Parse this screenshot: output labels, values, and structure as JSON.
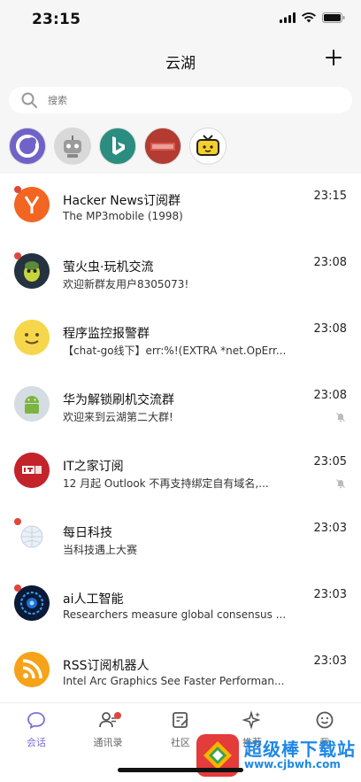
{
  "status": {
    "time": "23:15"
  },
  "header": {
    "title": "云湖",
    "add_icon": "plus-icon"
  },
  "search": {
    "placeholder": "搜索"
  },
  "stories": [
    {
      "name": "story-app-1",
      "icon": "rocket-moon-icon"
    },
    {
      "name": "story-app-2",
      "icon": "robot-icon"
    },
    {
      "name": "story-app-3",
      "icon": "bing-icon"
    },
    {
      "name": "story-app-4",
      "icon": "news-badge-icon"
    },
    {
      "name": "story-app-5",
      "icon": "tv-icon"
    }
  ],
  "chats": [
    {
      "title": "Hacker News订阅群",
      "subtitle": "The MP3mobile (1998)",
      "time": "23:15",
      "unread": true,
      "muted": false
    },
    {
      "title": "萤火虫·玩机交流",
      "subtitle": "欢迎新群友用户8305073!",
      "time": "23:08",
      "unread": true,
      "muted": false
    },
    {
      "title": "程序监控报警群",
      "subtitle": "【chat-go线下】err:%!(EXTRA *net.OpErr...",
      "time": "23:08",
      "unread": false,
      "muted": false
    },
    {
      "title": "华为解锁刷机交流群",
      "subtitle": "欢迎来到云湖第二大群!",
      "time": "23:08",
      "unread": false,
      "muted": true
    },
    {
      "title": "IT之家订阅",
      "subtitle": "12 月起 Outlook 不再支持绑定自有域名,...",
      "time": "23:05",
      "unread": false,
      "muted": true
    },
    {
      "title": "每日科技",
      "subtitle": "当科技遇上大赛",
      "time": "23:03",
      "unread": true,
      "muted": false
    },
    {
      "title": "ai人工智能",
      "subtitle": "Researchers measure global consensus ...",
      "time": "23:03",
      "unread": true,
      "muted": false
    },
    {
      "title": "RSS订阅机器人",
      "subtitle": "Intel Arc Graphics See Faster Performan...",
      "time": "23:03",
      "unread": false,
      "muted": false
    }
  ],
  "tabs": [
    {
      "label": "会话",
      "icon": "chat-bubble-icon",
      "active": true
    },
    {
      "label": "通讯录",
      "icon": "contacts-icon",
      "active": false,
      "badge": true
    },
    {
      "label": "社区",
      "icon": "community-icon",
      "active": false
    },
    {
      "label": "推荐",
      "icon": "sparkle-icon",
      "active": false
    },
    {
      "label": "我",
      "icon": "smile-icon",
      "active": false
    }
  ],
  "watermark": {
    "text": "超级棒下载站",
    "url": "www.cjbwh.com"
  },
  "colors": {
    "accent": "#7c6fd8",
    "unread_dot": "#e0463d",
    "header_bg": "#f6f6f7"
  }
}
